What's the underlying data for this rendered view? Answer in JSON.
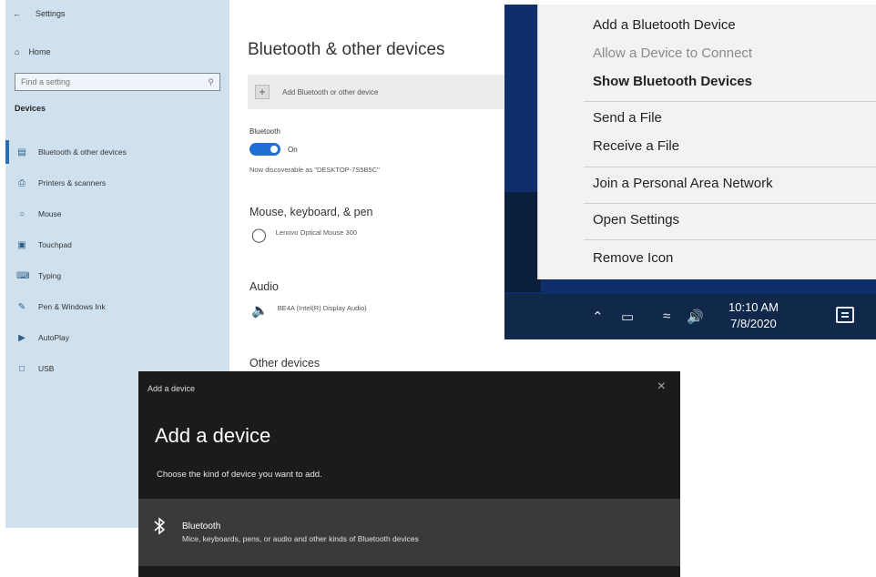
{
  "settings": {
    "title": "Settings",
    "home_label": "Home",
    "search_placeholder": "Find a setting",
    "section_label": "Devices",
    "nav": [
      {
        "label": "Bluetooth & other devices",
        "icon": "bluetooth-devices-icon"
      },
      {
        "label": "Printers & scanners",
        "icon": "printer-icon"
      },
      {
        "label": "Mouse",
        "icon": "mouse-icon"
      },
      {
        "label": "Touchpad",
        "icon": "touchpad-icon"
      },
      {
        "label": "Typing",
        "icon": "keyboard-icon"
      },
      {
        "label": "Pen & Windows Ink",
        "icon": "pen-icon"
      },
      {
        "label": "AutoPlay",
        "icon": "autoplay-icon"
      },
      {
        "label": "USB",
        "icon": "usb-icon"
      }
    ],
    "page_title": "Bluetooth & other devices",
    "add_device_label": "Add Bluetooth or other device",
    "bluetooth_label": "Bluetooth",
    "toggle_state": "On",
    "discoverable_text": "Now discoverable as \"DESKTOP-7S5B5C\"",
    "mouse_section": "Mouse, keyboard, & pen",
    "mouse_device": "Lenovo Optical Mouse 300",
    "audio_section": "Audio",
    "audio_device": "BE4A (Intel(R) Display Audio)",
    "other_section": "Other devices"
  },
  "tray_menu": {
    "items": [
      {
        "label": "Add a Bluetooth Device",
        "state": "normal"
      },
      {
        "label": "Allow a Device to Connect",
        "state": "disabled"
      },
      {
        "label": "Show Bluetooth Devices",
        "state": "bold"
      },
      {
        "label": "Send a File",
        "state": "normal"
      },
      {
        "label": "Receive a File",
        "state": "normal"
      },
      {
        "label": "Join a Personal Area Network",
        "state": "normal"
      },
      {
        "label": "Open Settings",
        "state": "normal"
      },
      {
        "label": "Remove Icon",
        "state": "normal"
      }
    ]
  },
  "taskbar": {
    "time": "10:10 AM",
    "date": "7/8/2020"
  },
  "dialog": {
    "window_title": "Add a device",
    "close_glyph": "×",
    "heading": "Add a device",
    "subtitle": "Choose the kind of device you want to add.",
    "option_title": "Bluetooth",
    "option_desc": "Mice, keyboards, pens, or audio and other kinds of Bluetooth devices"
  },
  "colors": {
    "accent": "#1f6fd6",
    "sidebar_bg": "#cfe1ef",
    "taskbar_bg": "#10284a",
    "dialog_bg": "#1b1b1b"
  }
}
